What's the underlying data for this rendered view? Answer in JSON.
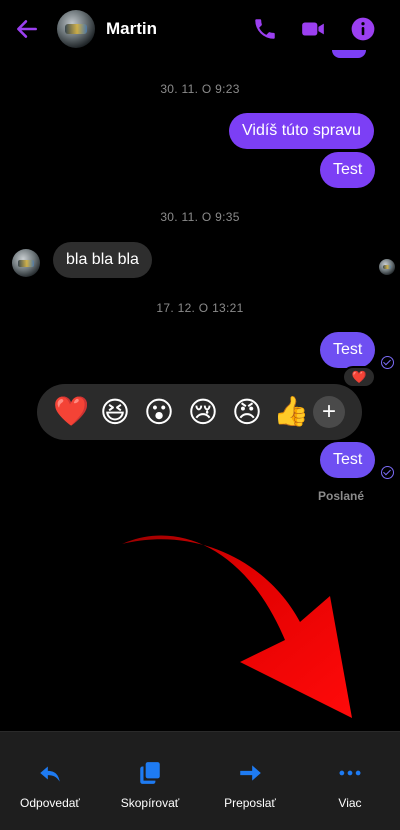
{
  "header": {
    "contact_name": "Martin",
    "icons": [
      "back-arrow-icon",
      "phone-icon",
      "video-camera-icon",
      "info-icon"
    ]
  },
  "messages": {
    "ts1": "30. 11. O 9:23",
    "out1": "Vidíš túto spravu",
    "out2": "Test",
    "ts2": "30. 11. O 9:35",
    "in1": "bla bla bla",
    "ts3": "17. 12. O 13:21",
    "out3": "Test",
    "out4": "Test",
    "status": "Poslané",
    "reaction": "❤️"
  },
  "reaction_bar": {
    "emojis": [
      "❤️",
      "😆",
      "😮",
      "😢",
      "😠",
      "👍"
    ],
    "more": "+"
  },
  "actions": {
    "reply": "Odpovedať",
    "copy": "Skopírovať",
    "forward": "Preposlať",
    "more": "Viac"
  },
  "colors": {
    "accent": "#7c3ff5",
    "action_blue": "#1e7bf2",
    "annotation_arrow": "#e00000"
  }
}
